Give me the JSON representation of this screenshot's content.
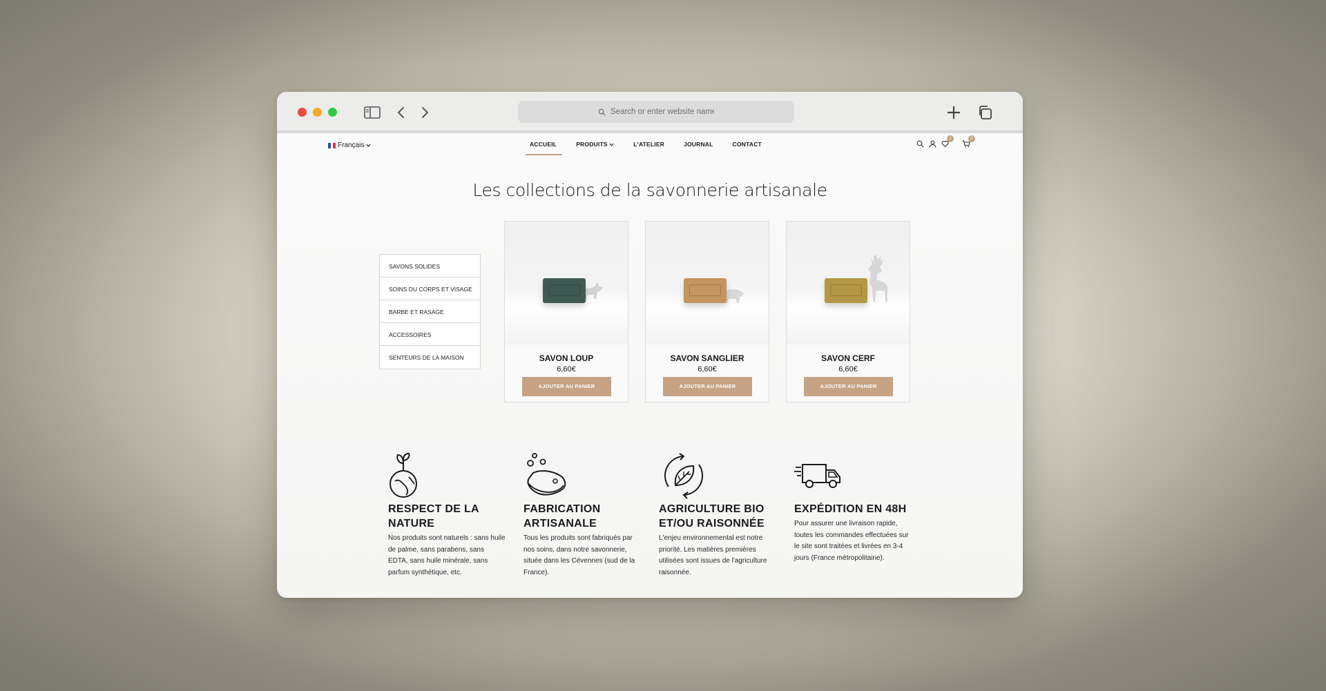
{
  "browser": {
    "address_placeholder": "Search or enter website name"
  },
  "site": {
    "language": "Français",
    "nav": [
      "ACCUEIL",
      "PRODUITS",
      "L'ATELIER",
      "JOURNAL",
      "CONTACT"
    ],
    "wishlist_count": "1",
    "cart_count": "0"
  },
  "heading": "Les collections de la savonnerie artisanale",
  "categories": [
    "SAVONS SOLIDES",
    "SOINS DU CORPS ET VISAGE",
    "BARBE ET RASAGE",
    "ACCESSOIRES",
    "SENTEURS DE LA MAISON"
  ],
  "products": [
    {
      "name": "SAVON LOUP",
      "price": "6,60€",
      "button": "AJOUTER AU PANIER",
      "soap_color": "#3f5a52"
    },
    {
      "name": "SAVON SANGLIER",
      "price": "6,60€",
      "button": "AJOUTER AU PANIER",
      "soap_color": "#c4955e"
    },
    {
      "name": "SAVON CERF",
      "price": "6,60€",
      "button": "AJOUTER AU PANIER",
      "soap_color": "#b49845"
    }
  ],
  "features": [
    {
      "title": "RESPECT DE LA NATURE",
      "text": "Nos produits sont naturels : sans huile de palme, sans parabens, sans EDTA, sans huile minérale, sans parfum synthétique, etc.",
      "icon": "earth-plant-icon"
    },
    {
      "title": "FABRICATION ARTISANALE",
      "text": "Tous les produits sont fabriqués par nos soins, dans notre savonnerie, située dans les Cévennes (sud de la France).",
      "icon": "soap-bubbles-icon"
    },
    {
      "title": "AGRICULTURE BIO ET/OU RAISONNÉE",
      "text": "L'enjeu environnemental est notre priorité. Les matières premières utilisées sont issues de l'agriculture raisonnée.",
      "icon": "leaf-cycle-icon"
    },
    {
      "title": "EXPÉDITION EN 48H",
      "text": "Pour assurer une livraison rapide, toutes les commandes effectuées sur le site sont traitées et livrées en 3-4 jours (France métropolitaine).",
      "icon": "delivery-truck-icon"
    }
  ],
  "colors": {
    "accent": "#c6a384"
  }
}
